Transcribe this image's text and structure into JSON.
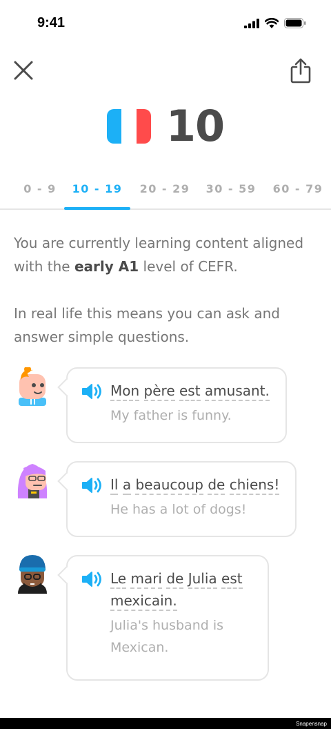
{
  "status_bar": {
    "time": "9:41",
    "icons": [
      "signal-icon",
      "wifi-icon",
      "battery-icon"
    ]
  },
  "toolbar": {
    "close_icon": "close-icon",
    "share_icon": "share-icon"
  },
  "header": {
    "flag": "france-flag",
    "flag_colors": [
      "#1cb0f6",
      "#ffffff",
      "#ff4b4b"
    ],
    "level": "10"
  },
  "tabs": [
    {
      "label": "0 - 9",
      "active": false
    },
    {
      "label": "10 - 19",
      "active": true
    },
    {
      "label": "20 - 29",
      "active": false
    },
    {
      "label": "30 - 59",
      "active": false
    },
    {
      "label": "60 - 79",
      "active": false
    }
  ],
  "description": {
    "line1_prefix": "You are currently learning content aligned with the",
    "line1_bold": "early A1",
    "line1_suffix": "level of CEFR.",
    "line2": "In real life this means you can ask and answer simple questions."
  },
  "examples": [
    {
      "avatar": "avatar-boy-orange-hair",
      "words": [
        "Mon",
        "père",
        "est",
        "amusant."
      ],
      "translation": "My father is funny."
    },
    {
      "avatar": "avatar-girl-purple-hair",
      "words": [
        "Il",
        "a",
        "beaucoup",
        "de",
        "chiens!"
      ],
      "translation": "He has a lot of dogs!"
    },
    {
      "avatar": "avatar-man-blue-beanie",
      "words": [
        "Le",
        "mari",
        "de",
        "Julia",
        "est",
        "mexicain."
      ],
      "translation": "Julia's husband is Mexican."
    }
  ],
  "colors": {
    "accent": "#1cb0f6",
    "text_dark": "#4b4b4b",
    "text_muted": "#777777",
    "text_light": "#afafaf",
    "border": "#e5e5e5"
  },
  "watermark": "Snapensnap"
}
